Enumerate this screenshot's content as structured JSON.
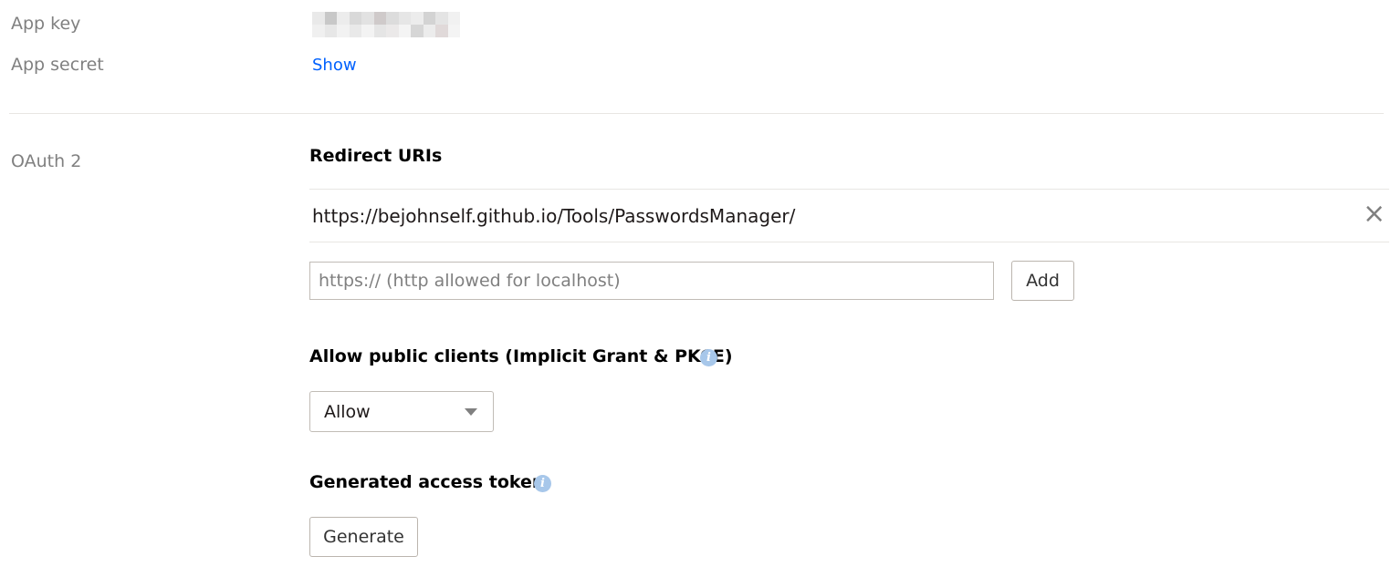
{
  "app_key": {
    "label": "App key"
  },
  "app_secret": {
    "label": "App secret",
    "action": "Show"
  },
  "oauth": {
    "section_label": "OAuth 2",
    "redirect_uris": {
      "heading": "Redirect URIs",
      "items": [
        "https://bejohnself.github.io/Tools/PasswordsManager/"
      ],
      "input_placeholder": "https:// (http allowed for localhost)",
      "add_label": "Add"
    },
    "public_clients": {
      "heading": "Allow public clients (Implicit Grant & PKCE)",
      "selected": "Allow",
      "info_glyph": "i"
    },
    "access_token": {
      "heading": "Generated access token",
      "button": "Generate",
      "info_glyph": "i"
    }
  },
  "colors": {
    "link": "#0061fe",
    "muted_label": "#808080",
    "info_icon": "#a7c7ea",
    "border": "#c1bcb6"
  }
}
